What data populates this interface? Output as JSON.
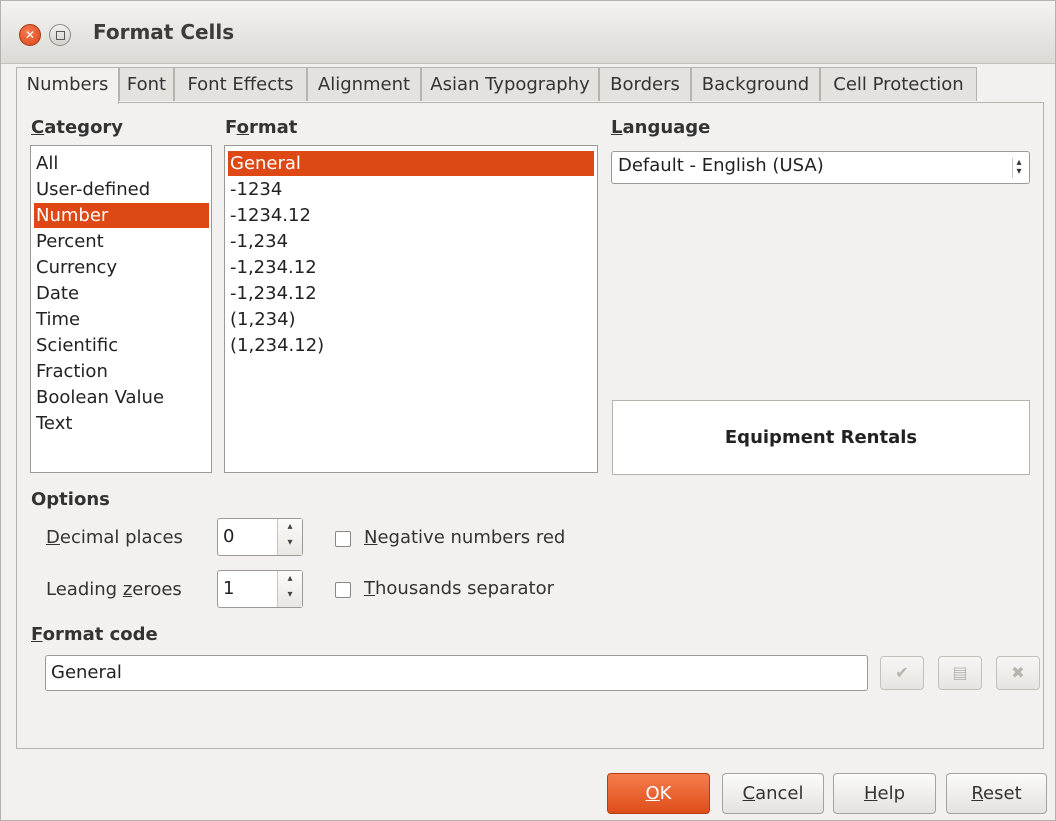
{
  "window": {
    "title": "Format Cells"
  },
  "tabs": [
    {
      "label": "Numbers",
      "active": true
    },
    {
      "label": "Font"
    },
    {
      "label": "Font Effects"
    },
    {
      "label": "Alignment"
    },
    {
      "label": "Asian Typography"
    },
    {
      "label": "Borders"
    },
    {
      "label": "Background"
    },
    {
      "label": "Cell Protection"
    }
  ],
  "category": {
    "label_mnemonic": "C",
    "label_rest": "ategory",
    "items": [
      "All",
      "User-defined",
      "Number",
      "Percent",
      "Currency",
      "Date",
      "Time",
      "Scientific",
      "Fraction",
      "Boolean Value",
      "Text"
    ],
    "selected": "Number"
  },
  "format": {
    "label_pre": "F",
    "label_mnemonic": "o",
    "label_rest": "rmat",
    "items": [
      "General",
      "-1234",
      "-1234.12",
      "-1,234",
      "-1,234.12",
      "-1,234.12",
      "(1,234)",
      "(1,234.12)"
    ],
    "selected": "General"
  },
  "language": {
    "label_mnemonic": "L",
    "label_rest": "anguage",
    "value": "Default - English (USA)"
  },
  "preview": {
    "text": "Equipment Rentals"
  },
  "options": {
    "heading": "Options",
    "decimal_places": {
      "label_mnemonic": "D",
      "label_rest": "ecimal places",
      "value": "0"
    },
    "leading_zeroes": {
      "label_pre": "Leading ",
      "label_mnemonic": "z",
      "label_rest": "eroes",
      "value": "1"
    },
    "negative_red": {
      "label_mnemonic": "N",
      "label_rest": "egative numbers red",
      "checked": false
    },
    "thousands_separator": {
      "label_mnemonic": "T",
      "label_rest": "housands separator",
      "checked": false
    }
  },
  "format_code": {
    "label_mnemonic": "F",
    "label_rest": "ormat code",
    "value": "General"
  },
  "icons": {
    "add": "checkmark-icon",
    "edit_comment": "comment-icon",
    "delete": "delete-icon"
  },
  "buttons": {
    "ok_mnemonic": "O",
    "ok_rest": "K",
    "cancel_mnemonic": "C",
    "cancel_rest": "ancel",
    "help_mnemonic": "H",
    "help_rest": "elp",
    "reset_mnemonic": "R",
    "reset_rest": "eset"
  },
  "colors": {
    "accent": "#dd4814",
    "ok_button": "#e9602d"
  }
}
